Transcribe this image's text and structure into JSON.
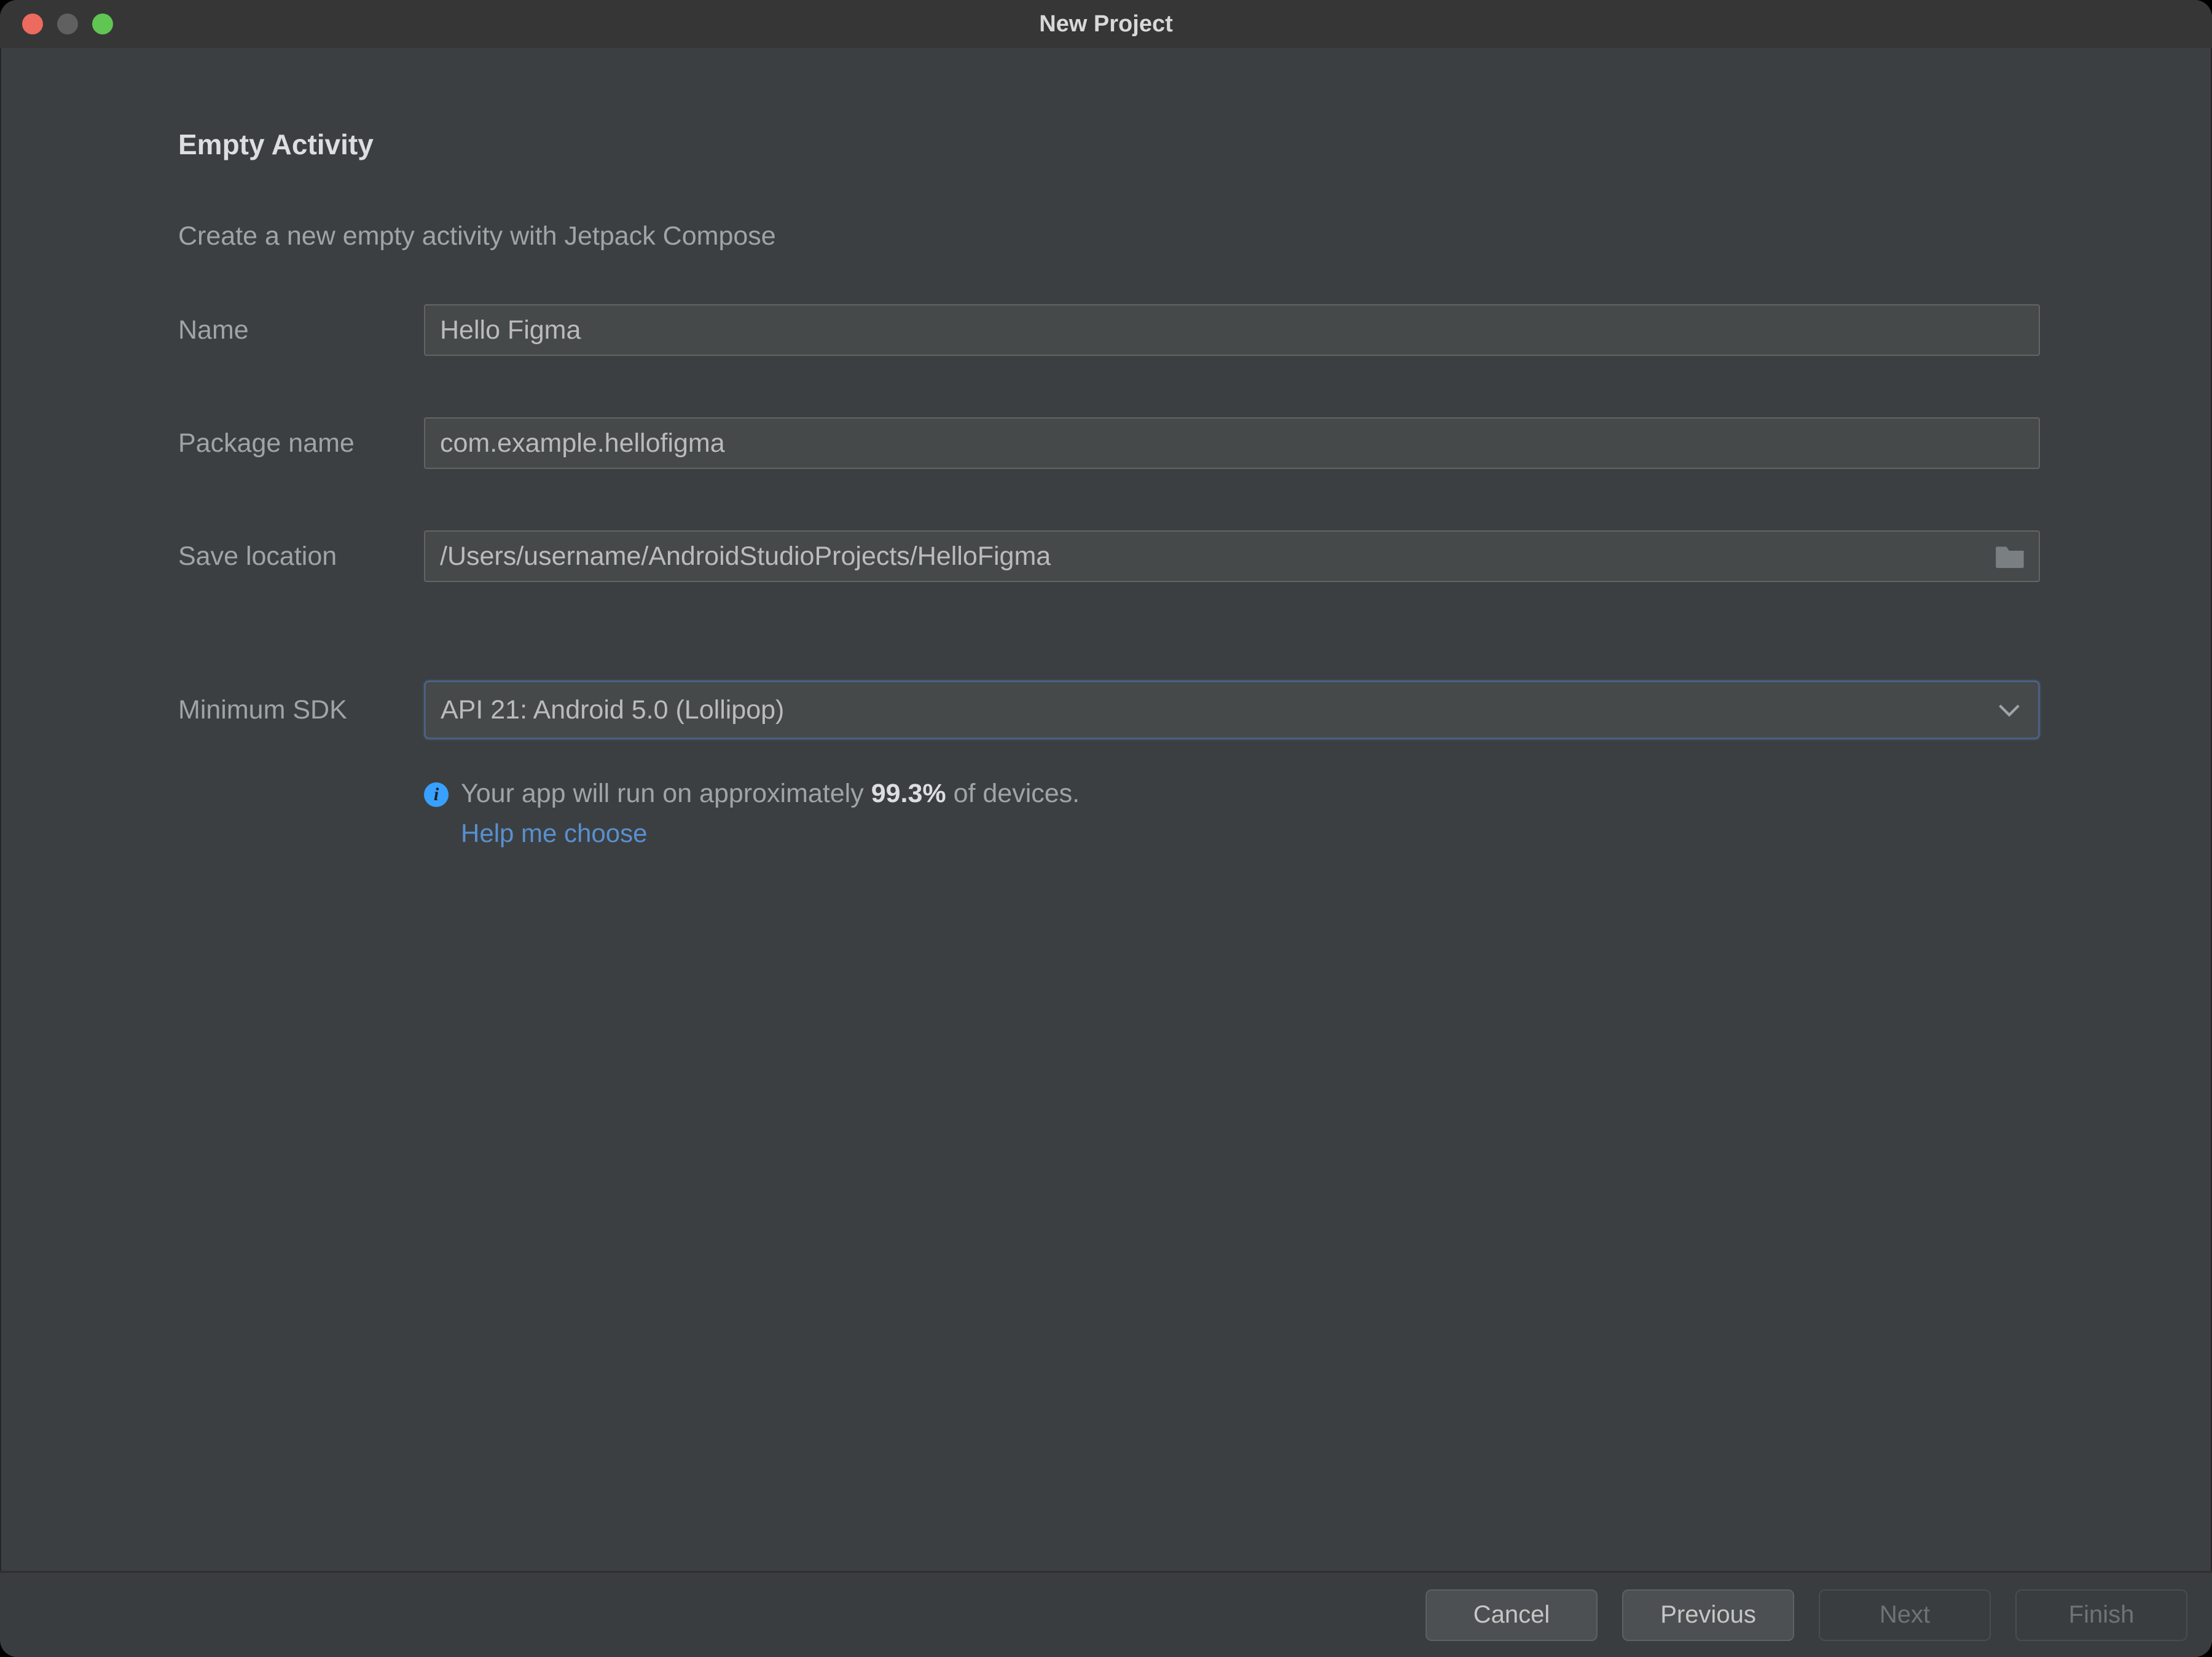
{
  "window": {
    "title": "New Project"
  },
  "header": {
    "heading": "Empty Activity",
    "description": "Create a new empty activity with Jetpack Compose"
  },
  "form": {
    "name": {
      "label": "Name",
      "value": "Hello Figma"
    },
    "package_name": {
      "label": "Package name",
      "value": "com.example.hellofigma"
    },
    "save_location": {
      "label": "Save location",
      "value": "/Users/username/AndroidStudioProjects/HelloFigma"
    },
    "minimum_sdk": {
      "label": "Minimum SDK",
      "value": "API 21: Android 5.0 (Lollipop)"
    }
  },
  "info": {
    "prefix": "Your app will run on approximately ",
    "percent": "99.3%",
    "suffix": " of devices.",
    "help_link": "Help me choose"
  },
  "footer": {
    "cancel": "Cancel",
    "previous": "Previous",
    "next": "Next",
    "finish": "Finish"
  }
}
